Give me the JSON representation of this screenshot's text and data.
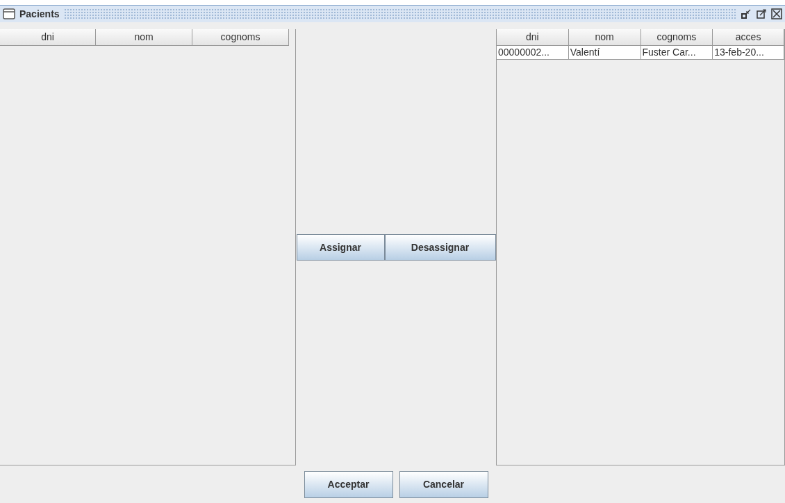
{
  "window": {
    "title": "Pacients"
  },
  "left_table": {
    "columns": [
      "dni",
      "nom",
      "cognoms"
    ]
  },
  "middle_buttons": [
    "Assignar",
    "Desassignar"
  ],
  "right_table": {
    "columns": [
      "dni",
      "nom",
      "cognoms",
      "acces"
    ],
    "rows": [
      {
        "cells": [
          "00000002...",
          "Valentí",
          "Fuster Car...",
          "13-feb-20..."
        ]
      }
    ]
  },
  "buttons": [
    "Acceptar",
    "Cancelar"
  ]
}
